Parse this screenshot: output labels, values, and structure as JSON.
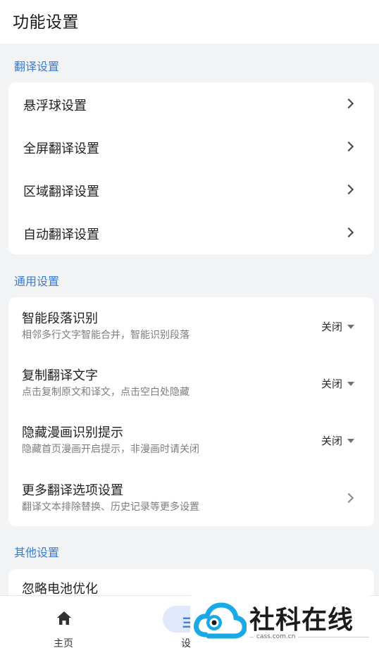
{
  "header": {
    "title": "功能设置"
  },
  "sections": {
    "translate": {
      "title": "翻译设置",
      "items": [
        {
          "label": "悬浮球设置"
        },
        {
          "label": "全屏翻译设置"
        },
        {
          "label": "区域翻译设置"
        },
        {
          "label": "自动翻译设置"
        }
      ]
    },
    "general": {
      "title": "通用设置",
      "items": [
        {
          "label": "智能段落识别",
          "desc": "相邻多行文字智能合并，智能识别段落",
          "value": "关闭"
        },
        {
          "label": "复制翻译文字",
          "desc": "点击复制原文和译文，点击空白处隐藏",
          "value": "关闭"
        },
        {
          "label": "隐藏漫画识别提示",
          "desc": "隐藏首页漫画开启提示，非漫画时请关闭",
          "value": "关闭"
        },
        {
          "label": "更多翻译选项设置",
          "desc": "翻译文本排除替换、历史记录等更多设置"
        }
      ]
    },
    "other": {
      "title": "其他设置",
      "items": [
        {
          "label": "忽略电池优化"
        }
      ]
    }
  },
  "bottom_nav": {
    "items": [
      {
        "label": "主页",
        "icon": "home-icon"
      },
      {
        "label": "设",
        "icon": "settings-icon",
        "icon_partial_glyph": "ヨ",
        "active": true
      }
    ]
  },
  "watermark": {
    "text": "社科在线",
    "url": "cass.com.cn"
  },
  "colors": {
    "accent": "#3a7bd5",
    "background": "#f2f3f5",
    "card": "#ffffff",
    "active_pill": "#dfe9fb"
  }
}
